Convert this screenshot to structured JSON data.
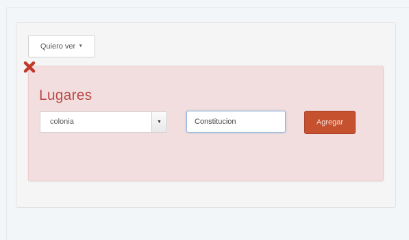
{
  "view_dropdown": {
    "label": "Quiero ver"
  },
  "panel": {
    "title": "Lugares",
    "remove_icon": "close-x-icon"
  },
  "form": {
    "select_value": "colonia",
    "input_value": "Constitucion",
    "add_label": "Agregar"
  },
  "colors": {
    "panel_bg": "#f2dede",
    "title": "#b94a48",
    "remove_icon": "#c0392b",
    "add_button": "#c5512e"
  }
}
